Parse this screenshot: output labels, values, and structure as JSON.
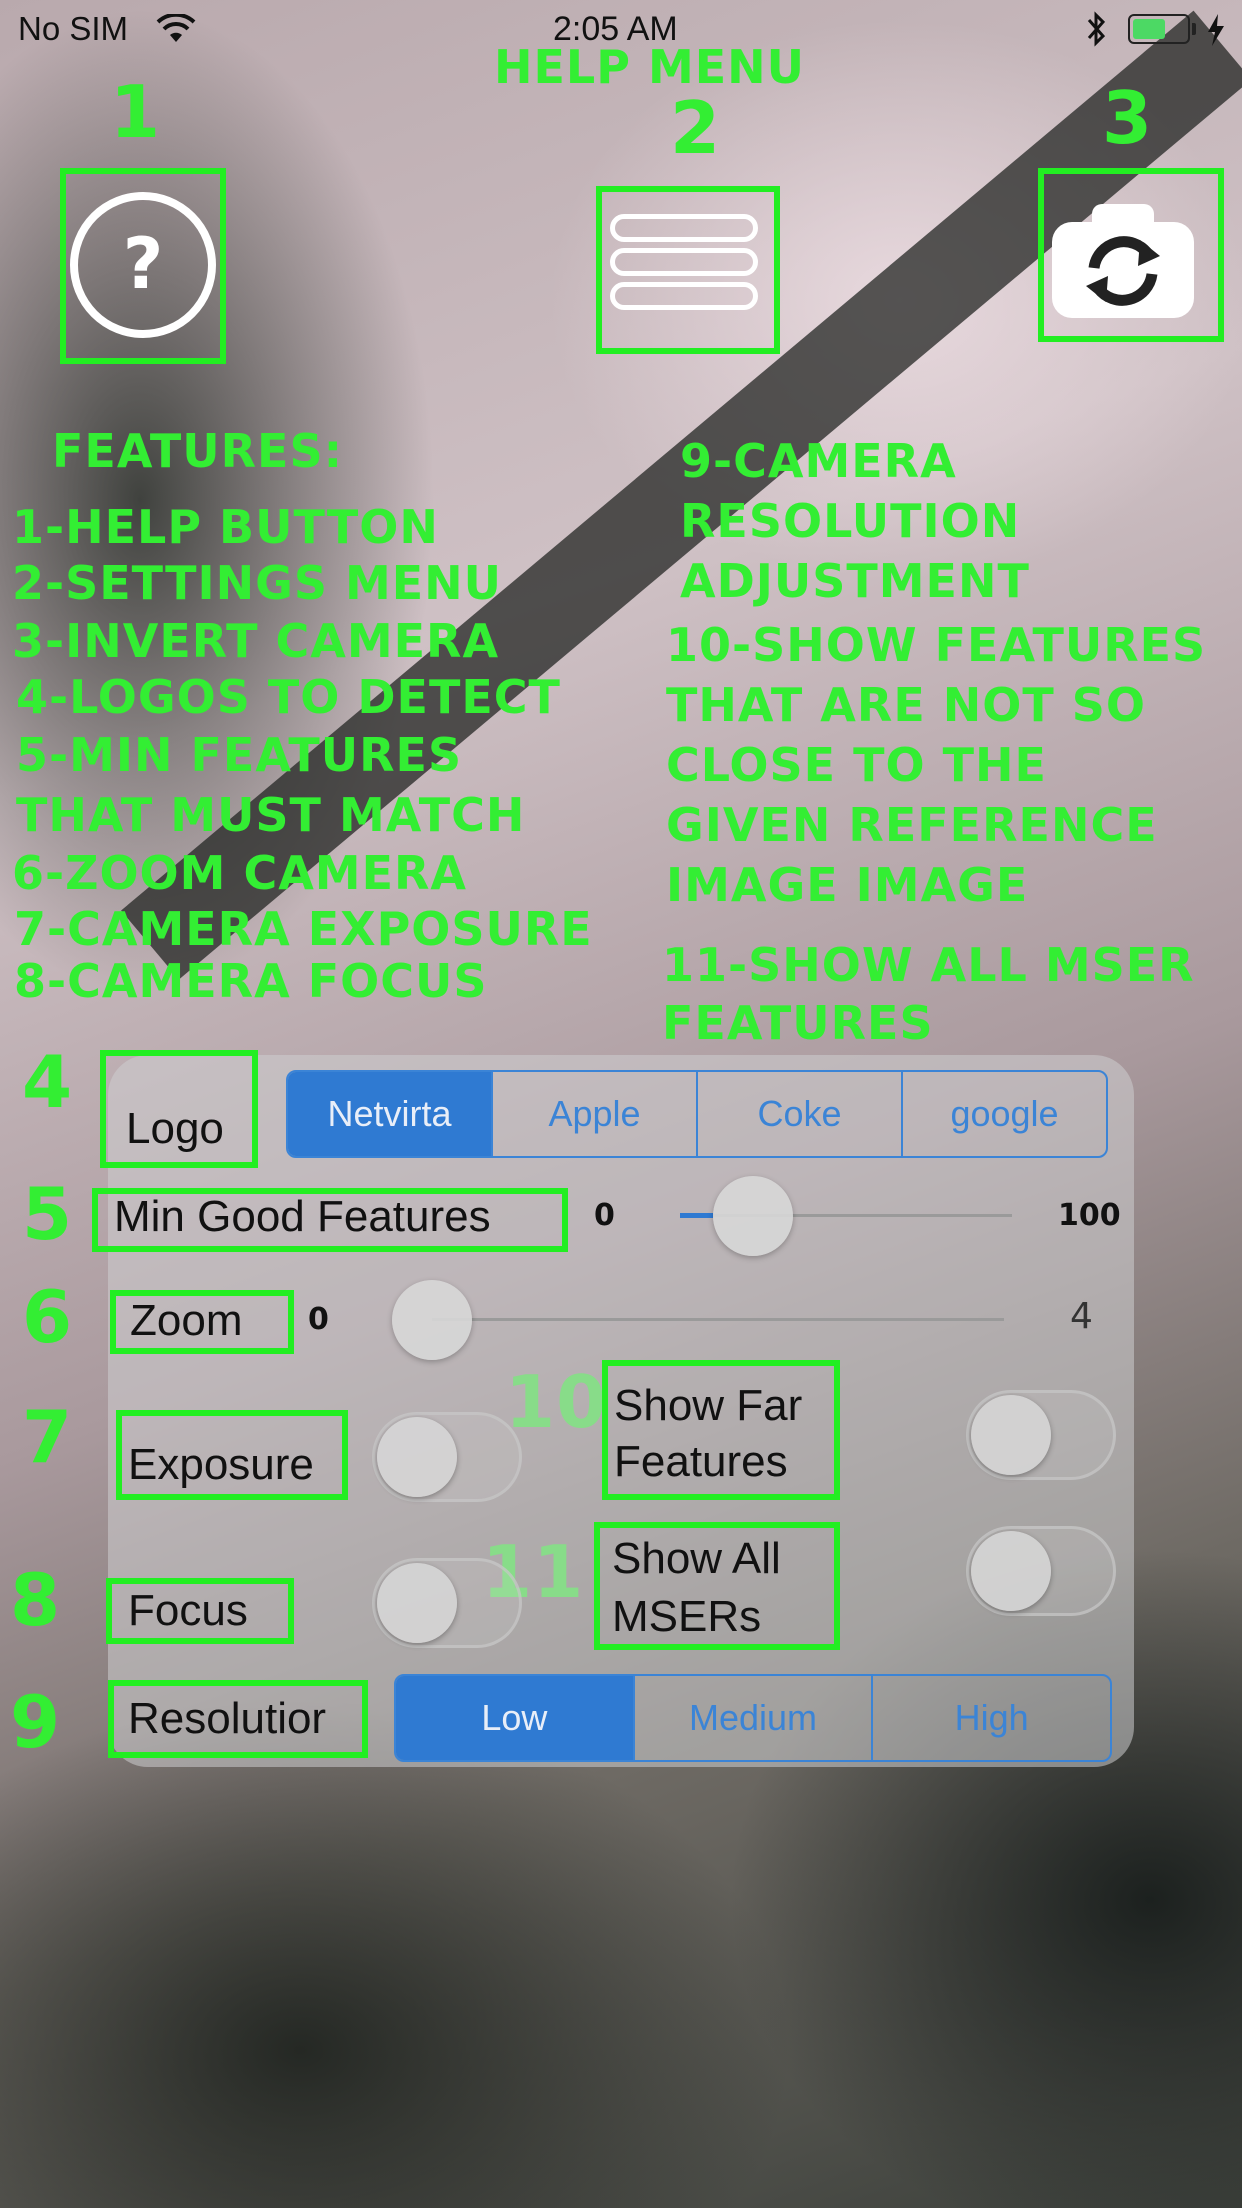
{
  "status_bar": {
    "carrier": "No SIM",
    "time": "2:05 AM"
  },
  "overlay": {
    "title": "HELP MENU",
    "numbers": [
      "1",
      "2",
      "3",
      "4",
      "5",
      "6",
      "7",
      "8",
      "9",
      "10",
      "11"
    ],
    "features_heading": "FEATURES:",
    "left_list": [
      "1-HELP BUTTON",
      "2-SETTINGS MENU",
      "3-INVERT CAMERA",
      "4-LOGOS TO DETECT",
      "5-MIN FEATURES",
      "THAT MUST MATCH",
      "6-ZOOM CAMERA",
      "7-CAMERA EXPOSURE",
      "8-CAMERA FOCUS"
    ],
    "right_list": [
      "9-CAMERA",
      "RESOLUTION",
      "ADJUSTMENT",
      "10-SHOW FEATURES",
      "THAT ARE NOT SO",
      "CLOSE TO THE",
      "GIVEN REFERENCE",
      "IMAGE IMAGE",
      "11-SHOW ALL MSER",
      "FEATURES"
    ],
    "color": "#33ee33"
  },
  "toolbar": {
    "help_glyph": "?",
    "help_icon": "help-circle-icon",
    "menu_icon": "hamburger-menu-icon",
    "camera_icon": "camera-switch-icon"
  },
  "settings": {
    "logo": {
      "label": "Logo",
      "options": [
        "Netvirta",
        "Apple",
        "Coke",
        "google"
      ],
      "selected": "Netvirta"
    },
    "min_good_features": {
      "label": "Min Good Features",
      "min": "0",
      "max": "100",
      "value": 5
    },
    "zoom": {
      "label": "Zoom",
      "min": "0",
      "max": "4",
      "value": 0
    },
    "exposure": {
      "label": "Exposure",
      "on": false
    },
    "focus": {
      "label": "Focus",
      "on": false
    },
    "show_far_features": {
      "label_line1": "Show Far",
      "label_line2": "Features",
      "on": false
    },
    "show_all_msers": {
      "label_line1": "Show All",
      "label_line2": "MSERs",
      "on": false
    },
    "resolution": {
      "label": "Resolutior",
      "options": [
        "Low",
        "Medium",
        "High"
      ],
      "selected": "Low"
    },
    "accent_color": "#2f7ad2"
  }
}
